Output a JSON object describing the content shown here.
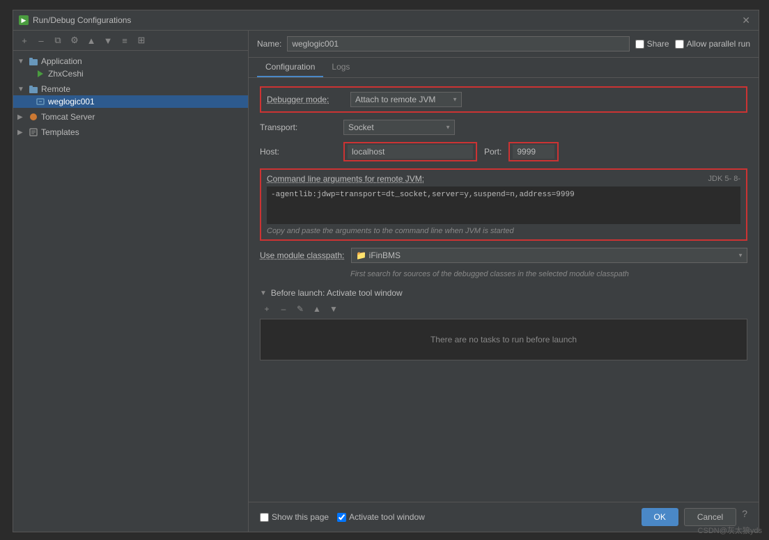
{
  "dialog": {
    "title": "Run/Debug Configurations",
    "close_label": "✕"
  },
  "sidebar": {
    "toolbar_buttons": [
      "+",
      "–",
      "⧉",
      "⚙",
      "▲",
      "▼",
      "≡",
      "⊞"
    ],
    "tree": {
      "application": {
        "label": "Application",
        "children": [
          {
            "label": "ZhxCeshi"
          }
        ]
      },
      "remote": {
        "label": "Remote",
        "children": [
          {
            "label": "weglogic001",
            "selected": true
          }
        ]
      },
      "tomcat": {
        "label": "Tomcat Server"
      },
      "templates": {
        "label": "Templates"
      }
    }
  },
  "name_row": {
    "label": "Name:",
    "value": "weglogic001",
    "share_label": "Share",
    "parallel_run_label": "Allow parallel run"
  },
  "tabs": [
    {
      "label": "Configuration",
      "active": true
    },
    {
      "label": "Logs",
      "active": false
    }
  ],
  "config": {
    "debugger_mode": {
      "label": "Debugger mode:",
      "value": "Attach to remote JVM"
    },
    "transport": {
      "label": "Transport:",
      "value": "Socket"
    },
    "host": {
      "label": "Host:",
      "value": "localhost"
    },
    "port": {
      "label": "Port:",
      "value": "9999"
    },
    "cmd_args": {
      "label": "Command line arguments for remote JVM:",
      "jdk_badge": "JDK 5-  8-",
      "value": "-agentlib:jdwp=transport=dt_socket,server=y,suspend=n,address=9999",
      "hint": "Copy and paste the arguments to the command line when JVM is started"
    },
    "module_classpath": {
      "label": "Use module classpath:",
      "value": "iFinBMS",
      "icon": "📁",
      "description": "First search for sources of the debugged classes in the selected module classpath"
    }
  },
  "before_launch": {
    "label": "Before launch: Activate tool window",
    "no_tasks_text": "There are no tasks to run before launch"
  },
  "bottom": {
    "show_page_label": "Show this page",
    "activate_tool_window_label": "Activate tool window",
    "ok_label": "OK",
    "cancel_label": "Cancel",
    "help_label": "?"
  },
  "watermark": "CSDN@灰太狼yds"
}
